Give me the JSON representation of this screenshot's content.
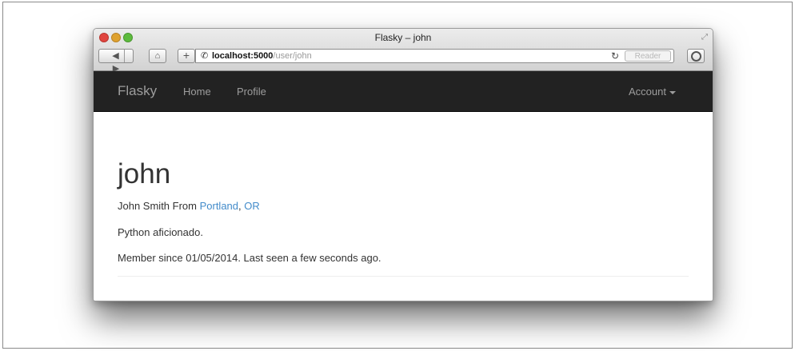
{
  "window": {
    "title": "Flasky – john"
  },
  "toolbar": {
    "back_icon": "◀",
    "forward_icon": "▶",
    "home_icon": "⌂",
    "add_icon": "+",
    "url_host": "localhost:5000",
    "url_path": "/user/john",
    "reload_icon": "↻",
    "reader_label": "Reader"
  },
  "navbar": {
    "brand": "Flasky",
    "links": [
      {
        "label": "Home"
      },
      {
        "label": "Profile"
      }
    ],
    "account_label": "Account"
  },
  "profile": {
    "username": "john",
    "name_prefix": "John Smith From ",
    "city": "Portland",
    "separator": ", ",
    "state": "OR",
    "about": "Python aficionado.",
    "member_text": "Member since 01/05/2014. Last seen a few seconds ago."
  },
  "colors": {
    "navbar_bg": "#222222",
    "navbar_text": "#9d9d9d",
    "link": "#428bca",
    "close": "#e0443e",
    "minimize": "#dfa22f",
    "zoom": "#5dbb3d"
  }
}
